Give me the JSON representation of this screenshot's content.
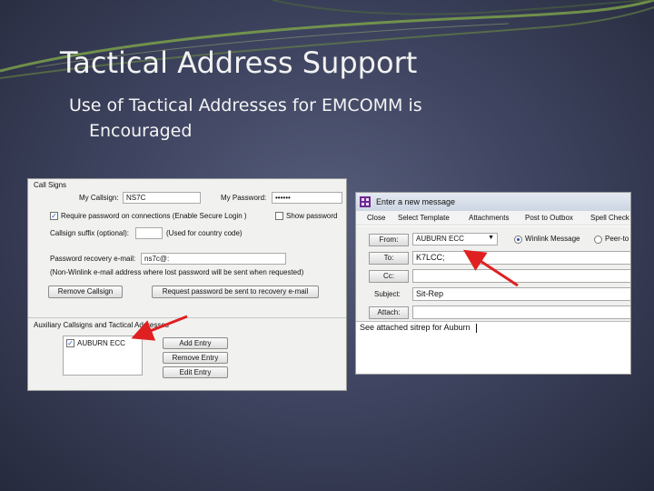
{
  "slide": {
    "title": "Tactical Address Support",
    "bullet_line1": "Use of Tactical Addresses for EMCOMM is",
    "bullet_line2": "Encouraged"
  },
  "callsigns_dialog": {
    "group_title": "Call Signs",
    "my_callsign_label": "My Callsign:",
    "my_callsign_value": "NS7C",
    "my_password_label": "My Password:",
    "my_password_value": "••••••",
    "require_password_checked": true,
    "require_password_label": "Require password on connections  (Enable Secure Login )",
    "show_password_checked": false,
    "show_password_label": "Show password",
    "suffix_label": "Callsign suffix (optional):",
    "suffix_value": "",
    "suffix_note": "(Used for country code)",
    "recovery_label": "Password recovery e-mail:",
    "recovery_value": "ns7c@:",
    "recovery_note": "(Non-Winlink e-mail address where lost password will be sent when requested)",
    "remove_callsign_button": "Remove Callsign",
    "request_password_button": "Request password be sent to recovery e-mail",
    "aux_group_title": "Auxiliary Callsigns and Tactical Addresses",
    "aux_items": [
      {
        "checked": true,
        "label": "AUBURN ECC"
      }
    ],
    "add_entry_button": "Add Entry",
    "remove_entry_button": "Remove Entry",
    "edit_entry_button": "Edit Entry"
  },
  "message_window": {
    "title": "Enter a new message",
    "menu": [
      "Close",
      "Select Template",
      "Attachments",
      "Post to Outbox",
      "Spell Check"
    ],
    "from_button": "From:",
    "from_value": "AUBURN ECC",
    "to_button": "To:",
    "to_value": "K7LCC;",
    "cc_button": "Cc:",
    "cc_value": "",
    "subject_label": "Subject:",
    "subject_value": "Sit-Rep",
    "attach_button": "Attach:",
    "attach_value": "",
    "radio_winlink_label": "Winlink Message",
    "radio_peer_label": "Peer-to",
    "body_text": "See attached sitrep for Auburn"
  },
  "colors": {
    "background": "#3f4561",
    "title_text": "#f2f2f2",
    "arrow": "#e02020",
    "swoosh": "#7fa64a"
  }
}
